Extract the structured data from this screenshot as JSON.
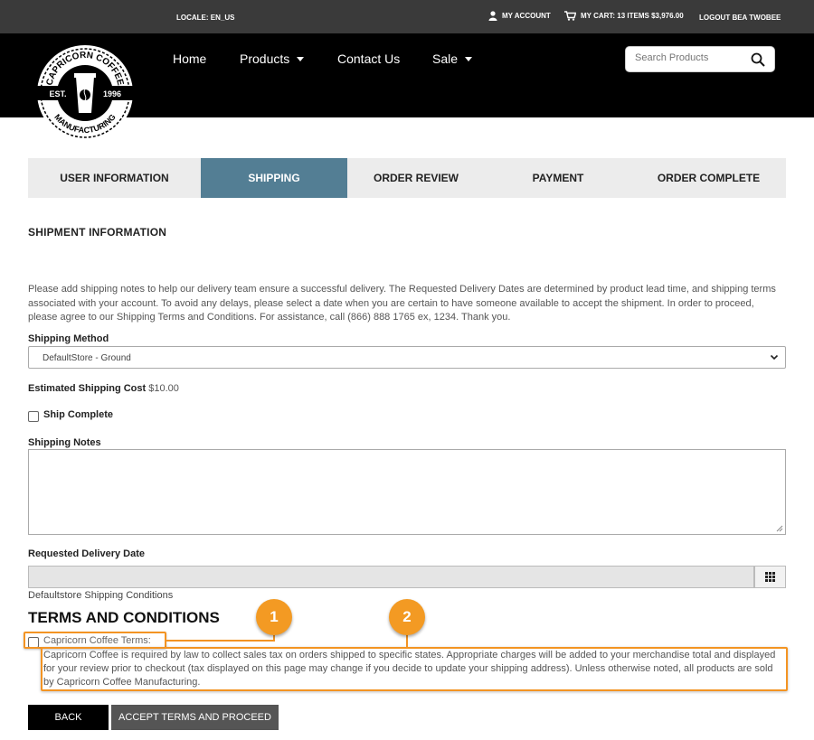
{
  "topbar": {
    "locale": "LOCALE: EN_US",
    "my_account": "MY ACCOUNT",
    "cart": "MY CART: 13 ITEMS  $3,976.00",
    "logout": "LOGOUT BEA TWOBEE"
  },
  "logo": {
    "name_top": "CAPRICORN COFFEE",
    "name_bottom": "MANUFACTURING",
    "est": "EST.",
    "year": "1996"
  },
  "nav": {
    "items": [
      {
        "label": "Home"
      },
      {
        "label": "Products"
      },
      {
        "label": "Contact Us"
      },
      {
        "label": "Sale"
      }
    ]
  },
  "search": {
    "placeholder": "Search Products"
  },
  "steps": {
    "items": [
      {
        "label": "USER INFORMATION"
      },
      {
        "label": "SHIPPING"
      },
      {
        "label": "ORDER REVIEW"
      },
      {
        "label": "PAYMENT"
      },
      {
        "label": "ORDER COMPLETE"
      }
    ],
    "active": "SHIPPING",
    "active_color": "#537e94"
  },
  "shipment": {
    "heading": "SHIPMENT INFORMATION",
    "intro": "Please add shipping notes to help our delivery team ensure a successful delivery. The Requested Delivery Dates are determined by product lead time, and shipping terms associated with your account. To avoid any delays, please select a date when you are certain to have someone available to accept the shipment. In order to proceed, please agree to our Shipping Terms and Conditions. For assistance, call (866) 888 1765 ex, 1234. Thank you.",
    "method_label": "Shipping Method",
    "method_value": "DefaultStore - Ground",
    "cost_label": "Estimated Shipping Cost",
    "cost_value": "$10.00",
    "ship_complete_label": "Ship Complete",
    "notes_label": "Shipping Notes",
    "date_label": "Requested Delivery Date",
    "conditions_link": "Defaultstore Shipping Conditions"
  },
  "terms": {
    "heading": "TERMS AND CONDITIONS",
    "checkbox_label": "Capricorn Coffee Terms:",
    "text": "Capricorn Coffee is required by law to collect sales tax on orders shipped to specific states. Appropriate charges will be added to your merchandise total and displayed for your review prior to checkout (tax displayed on this page may change if you decide to update your shipping address). Unless otherwise noted, all products are sold by Capricorn Coffee Manufacturing."
  },
  "callouts": {
    "one": "1",
    "two": "2",
    "color": "#f39423"
  },
  "buttons": {
    "back": "BACK",
    "accept": "ACCEPT TERMS AND PROCEED"
  }
}
